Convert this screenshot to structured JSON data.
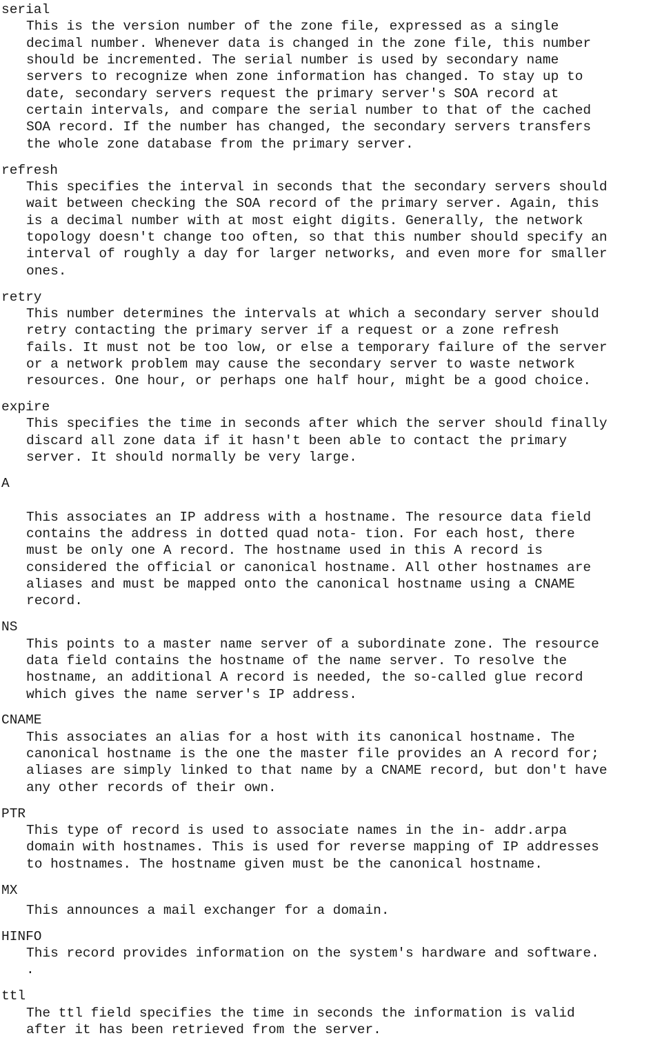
{
  "document": {
    "type": "manual-page",
    "topic": "DNS zone file SOA fields and resource record types",
    "text_color": "#1a1a1a",
    "background_color": "#ffffff",
    "sections": [
      {
        "term": "serial",
        "lines": [
          "This is the version number of the zone file, expressed as a single",
          "decimal number. Whenever data is changed in the zone file, this number",
          "should be incremented. The serial number is used by secondary name",
          "servers to recognize when zone information has changed. To stay up to",
          "date, secondary servers request the primary server's SOA record at",
          "certain intervals, and compare the serial number to that of the cached",
          "SOA record. If the number has changed, the secondary servers transfers",
          "the whole zone database from the primary server."
        ]
      },
      {
        "term": "refresh",
        "lines": [
          "This specifies the interval in seconds that the secondary servers should",
          "wait between checking the SOA record of the primary server. Again, this",
          "is a decimal number with at most eight digits. Generally, the network",
          "topology doesn't change too often, so that this number should specify an",
          "interval of roughly a day for larger networks, and even more for smaller",
          "ones."
        ]
      },
      {
        "term": "retry",
        "lines": [
          "This number determines the intervals at which a secondary server should",
          "retry contacting the primary server if a request or a zone refresh",
          "fails. It must not be too low, or else a temporary failure of the server",
          "or a network problem may cause the secondary server to waste network",
          "resources. One hour, or perhaps one half hour, might be a good choice."
        ]
      },
      {
        "term": "expire",
        "lines": [
          "This specifies the time in seconds after which the server should finally",
          "discard all zone data if it hasn't been able to contact the primary",
          "server. It should normally be very large."
        ]
      },
      {
        "term": "A",
        "extra_gap": true,
        "lines": [
          "This associates an IP address with a hostname. The resource data field",
          "contains the address in dotted quad nota- tion. For each host, there",
          "must be only one A record. The hostname used in this A record is",
          "considered the official or canonical hostname. All other hostnames are",
          "aliases and must be mapped onto the canonical hostname using a CNAME",
          "record."
        ]
      },
      {
        "term": "NS",
        "lines": [
          "This points to a master name server of a subordinate zone. The resource",
          "data field contains the hostname of the name server. To resolve the",
          "hostname, an additional A record is needed, the so-called glue record",
          "which gives the name server's IP address."
        ]
      },
      {
        "term": "CNAME",
        "lines": [
          "This associates an alias for a host with its canonical hostname. The",
          "canonical hostname is the one the master file provides an A record for;",
          "aliases are simply linked to that name by a CNAME record, but don't have",
          "any other records of their own."
        ]
      },
      {
        "term": "PTR",
        "lines": [
          "This type of record is used to associate names in the in- addr.arpa",
          "domain with hostnames. This is used for reverse mapping of IP addresses",
          "to hostnames. The hostname given must be the canonical hostname."
        ]
      },
      {
        "term": "MX",
        "small_gap": true,
        "lines": [
          "This announces a mail exchanger for a domain."
        ]
      },
      {
        "term": "HINFO",
        "lines": [
          "This record provides information on the system's hardware and software."
        ],
        "trailing_stray": "."
      },
      {
        "term": "ttl",
        "lines": [
          "The ttl field specifies the time in seconds the information is valid",
          "after it has been retrieved from the server."
        ]
      }
    ]
  }
}
